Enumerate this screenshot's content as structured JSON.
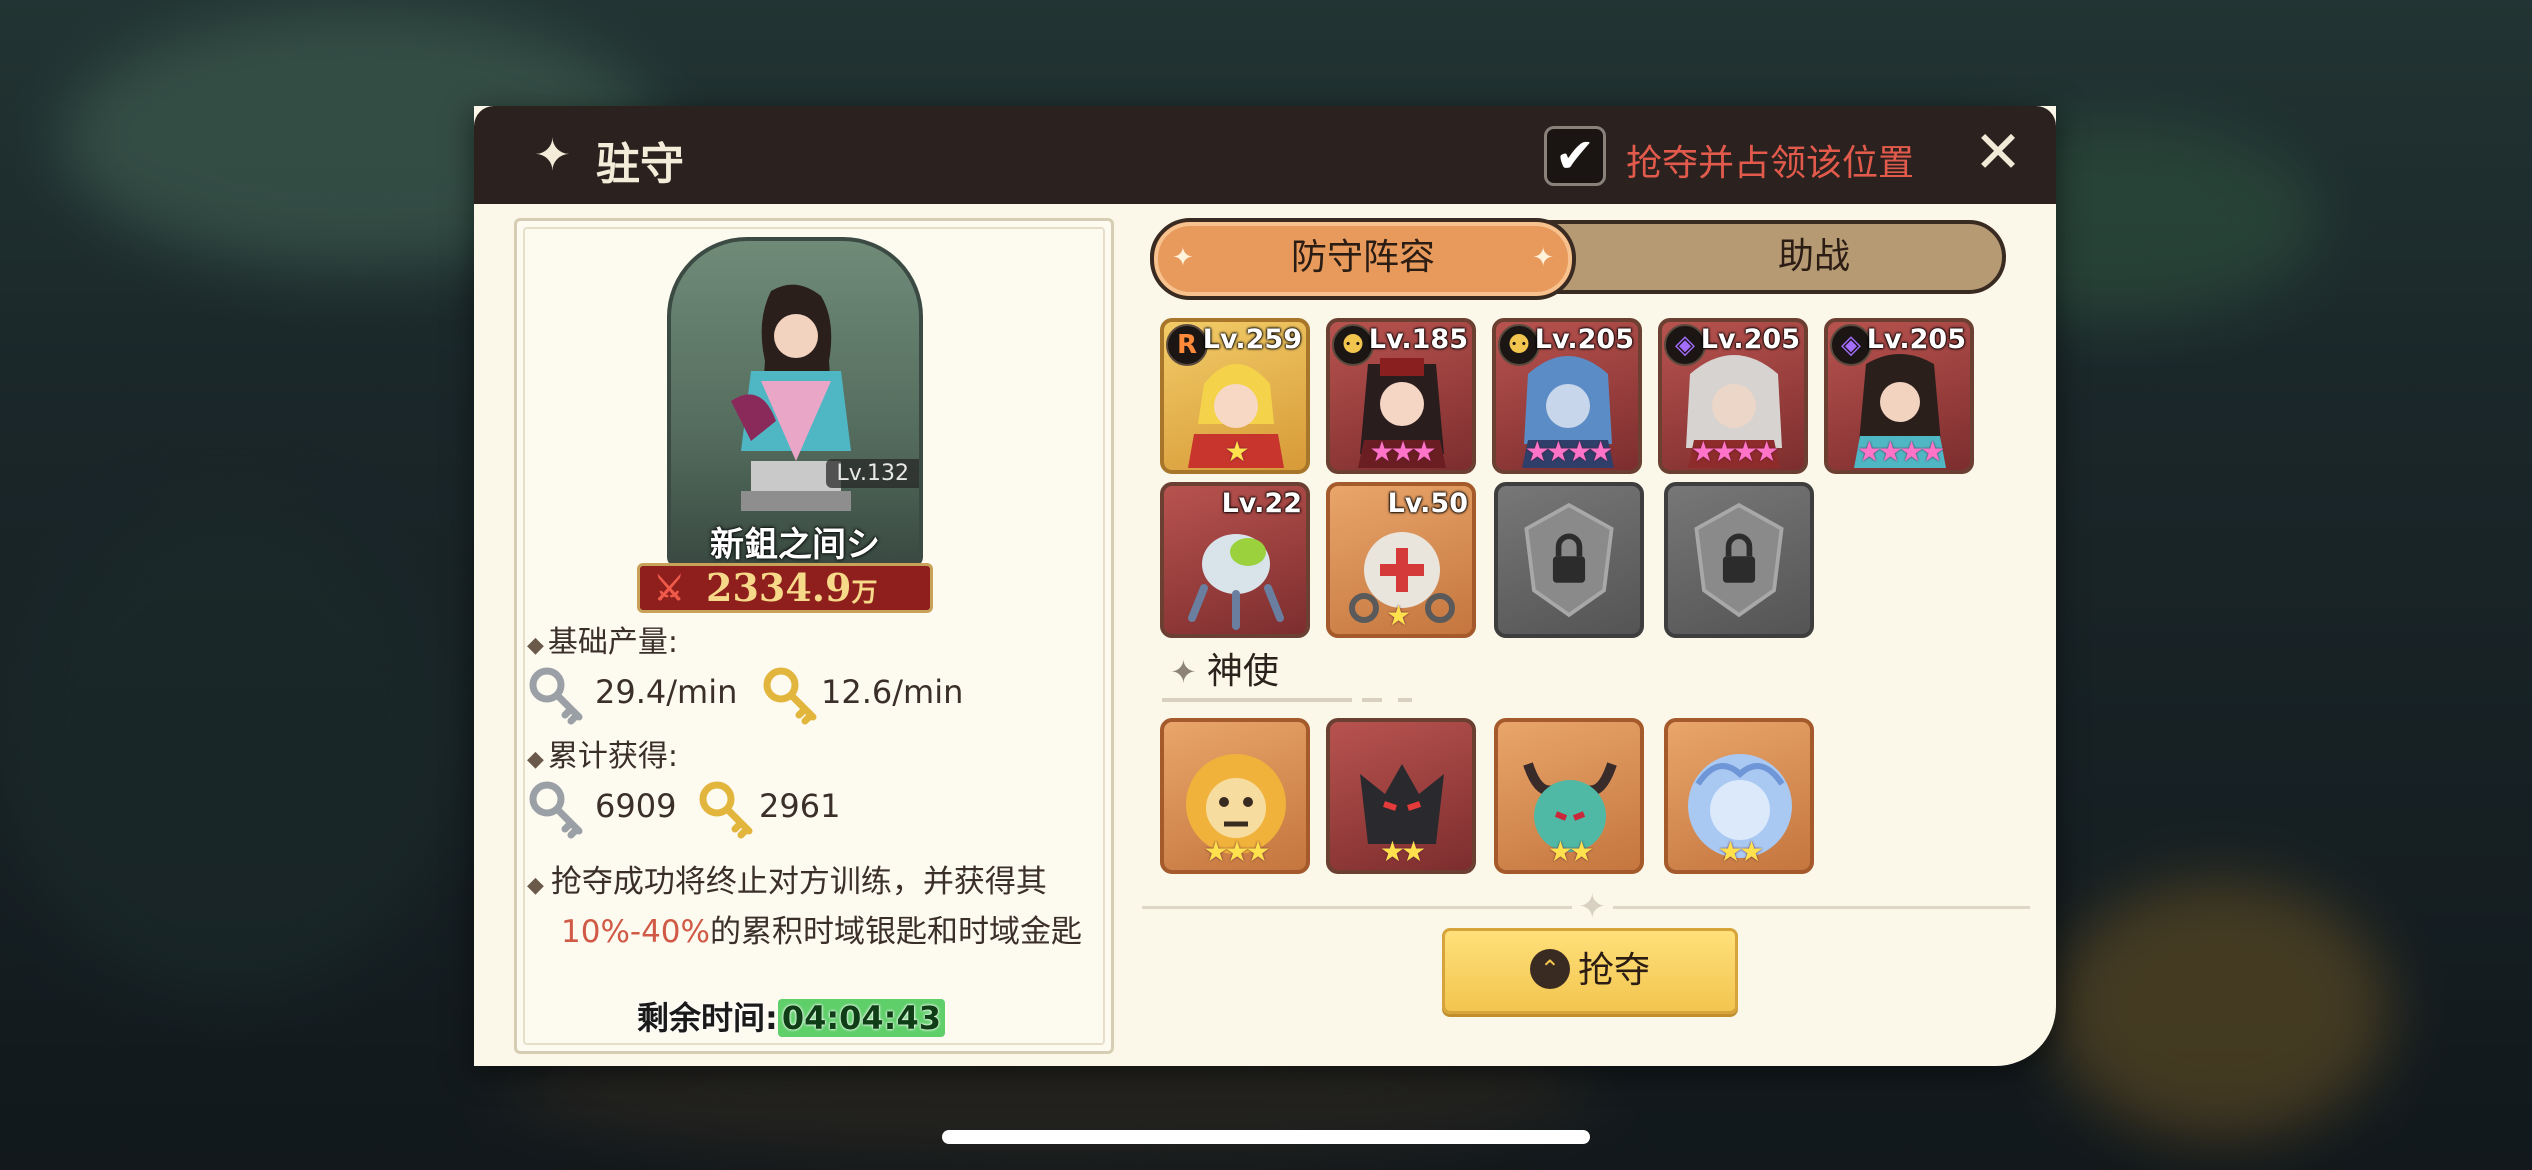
{
  "dialog": {
    "title": "驻守",
    "checkbox_checked": true,
    "checkbox_label": "抢夺并占领该位置",
    "close_icon": "close-icon"
  },
  "player": {
    "level": "Lv.132",
    "name": "新鉏之间シ",
    "power": "2334.9",
    "power_unit": "万"
  },
  "stats": {
    "base_output_label": "基础产量:",
    "silver_rate": "29.4/min",
    "gold_rate": "12.6/min",
    "accumulated_label": "累计获得:",
    "silver_total": "6909",
    "gold_total": "2961",
    "desc_line1": "抢夺成功将终止对方训练，并获得其",
    "desc_highlight": "10%-40%",
    "desc_line2": "的累积时域银匙和时域金匙",
    "remaining_label": "剩余时间:",
    "remaining_time": "04:04:43"
  },
  "tabs": [
    {
      "label": "防守阵容",
      "active": true
    },
    {
      "label": "助战",
      "active": false
    }
  ],
  "heroes": [
    {
      "level": "Lv.259",
      "faction": "R",
      "faction_color": "#ff8a3a",
      "stars": "★",
      "star_color": "yellow",
      "frame": "gold"
    },
    {
      "level": "Lv.185",
      "faction": "⚉",
      "faction_color": "#f2c54f",
      "stars": "★★★",
      "star_color": "pink",
      "frame": "red"
    },
    {
      "level": "Lv.205",
      "faction": "⚉",
      "faction_color": "#f2c54f",
      "stars": "★★★★",
      "star_color": "pink",
      "frame": "red"
    },
    {
      "level": "Lv.205",
      "faction": "◈",
      "faction_color": "#a46cff",
      "stars": "★★★★",
      "star_color": "pink",
      "frame": "red"
    },
    {
      "level": "Lv.205",
      "faction": "◈",
      "faction_color": "#a46cff",
      "stars": "★★★★",
      "star_color": "pink",
      "frame": "red"
    }
  ],
  "pets": [
    {
      "level": "Lv.22",
      "frame": "red"
    },
    {
      "level": "Lv.50",
      "frame": "orange",
      "stars": "★"
    }
  ],
  "divine_label": "神使",
  "divines": [
    {
      "stars": "★★★"
    },
    {
      "stars": "★★"
    },
    {
      "stars": "★★"
    },
    {
      "stars": "★★"
    }
  ],
  "rob_button": "抢夺",
  "colors": {
    "header_bg": "#2b2220",
    "accent_red": "#e15a4b",
    "tab_active": "#e79a5c",
    "button_yellow": "#f2c54f",
    "timer_green": "#5fcf6a"
  }
}
